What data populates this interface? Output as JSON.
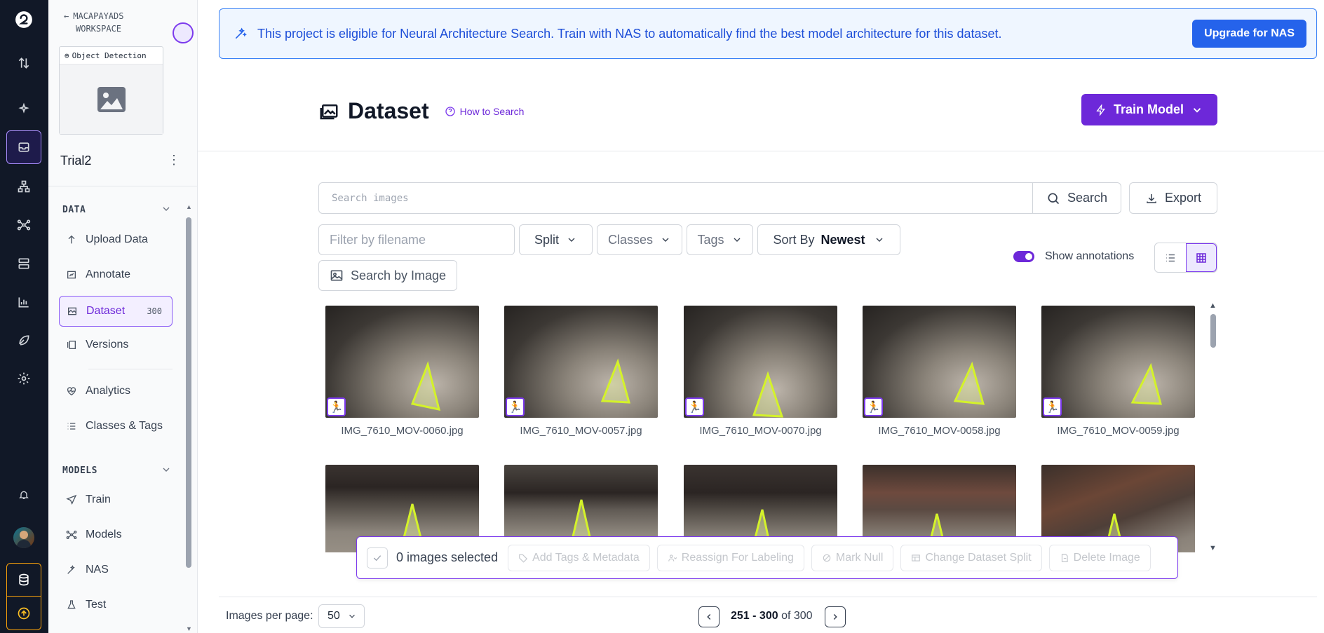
{
  "rail": {
    "icons": [
      "logo-icon",
      "transfer-icon",
      "sparkle-icon",
      "inbox-icon",
      "hierarchy-icon",
      "graph-icon",
      "server-icon",
      "bar-chart-icon",
      "leaf-icon",
      "gear-icon",
      "bell-icon",
      "user-avatar",
      "database-icon",
      "upload-icon"
    ]
  },
  "sidebar": {
    "workspace_line1": "MACAPAYADS",
    "workspace_line2": "WORKSPACE",
    "project_type": "Object Detection",
    "project_name": "Trial2",
    "data_section": "DATA",
    "data_items": [
      {
        "label": "Upload Data",
        "icon": "upload-arrow-icon"
      },
      {
        "label": "Annotate",
        "icon": "annotate-icon"
      },
      {
        "label": "Dataset",
        "icon": "dataset-icon",
        "count": "300"
      },
      {
        "label": "Versions",
        "icon": "versions-icon"
      },
      {
        "label": "Analytics",
        "icon": "heart-pulse-icon"
      },
      {
        "label": "Classes & Tags",
        "icon": "list-icon"
      }
    ],
    "models_section": "MODELS",
    "model_items": [
      {
        "label": "Train",
        "icon": "send-icon"
      },
      {
        "label": "Models",
        "icon": "models-icon"
      },
      {
        "label": "NAS",
        "icon": "wand-icon"
      },
      {
        "label": "Test",
        "icon": "test-icon"
      }
    ]
  },
  "banner": {
    "text": "This project is eligible for Neural Architecture Search. Train with NAS to automatically find the best model architecture for this dataset.",
    "button": "Upgrade for NAS"
  },
  "header": {
    "title": "Dataset",
    "help": "How to Search",
    "train": "Train Model"
  },
  "toolbar": {
    "search_placeholder": "Search images",
    "search_button": "Search",
    "export_button": "Export",
    "filename_placeholder": "Filter by filename",
    "split": "Split",
    "classes": "Classes",
    "tags": "Tags",
    "sort_label": "Sort By",
    "sort_value": "Newest",
    "search_by_image": "Search by Image",
    "show_annotations": "Show annotations"
  },
  "images": [
    "IMG_7610_MOV-0060.jpg",
    "IMG_7610_MOV-0057.jpg",
    "IMG_7610_MOV-0070.jpg",
    "IMG_7610_MOV-0058.jpg",
    "IMG_7610_MOV-0059.jpg"
  ],
  "selection": {
    "count_text": "0 images selected",
    "actions": [
      "Add Tags & Metadata",
      "Reassign For Labeling",
      "Mark Null",
      "Change Dataset Split",
      "Delete Image"
    ]
  },
  "footer": {
    "per_page_label": "Images per page:",
    "per_page_value": "50",
    "range": "251 - 300",
    "of_text": "of 300"
  },
  "colors": {
    "accent": "#7c3aed",
    "banner_bg": "#eff6ff",
    "banner_border": "#3b82f6",
    "upgrade_btn": "#2563eb"
  }
}
